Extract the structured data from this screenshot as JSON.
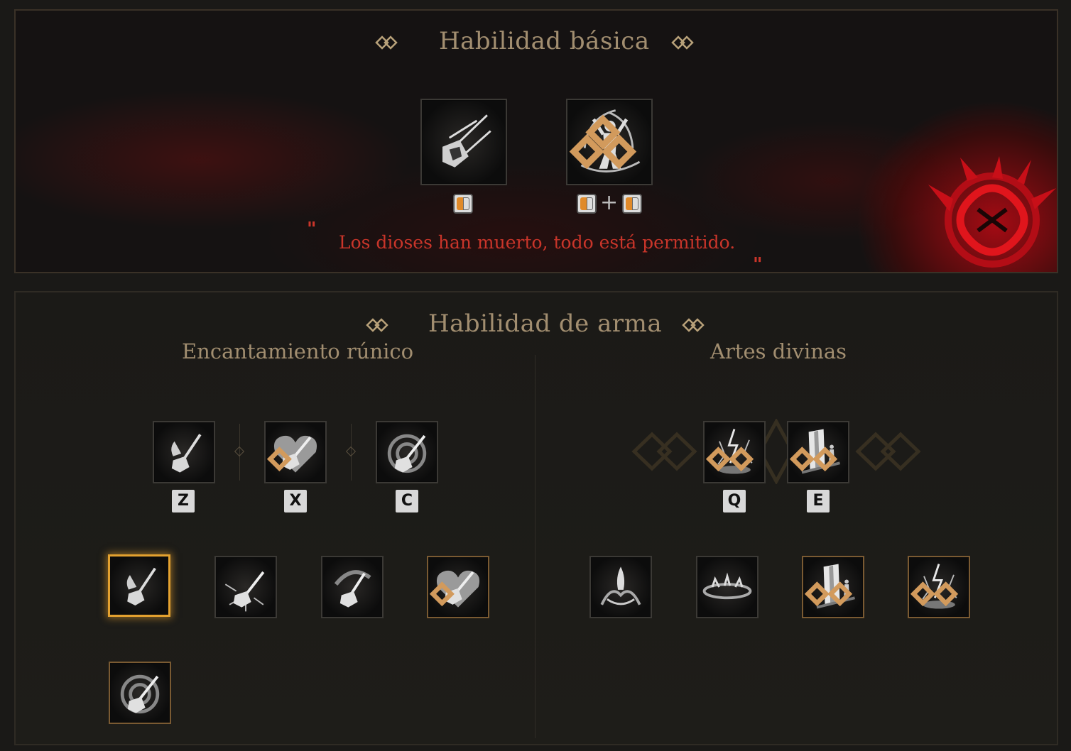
{
  "basic": {
    "title": "Habilidad básica",
    "skills": [
      {
        "icon": "hammer-dash-icon",
        "input": "left-click"
      },
      {
        "icon": "divine-figure-icon",
        "input": "left-click + left-click"
      }
    ],
    "quote": "Los dioses han muerto, todo está permitido.",
    "quote_open": "\"",
    "quote_close": "\""
  },
  "weapon": {
    "title": "Habilidad de arma",
    "left": {
      "title": "Encantamiento rúnico",
      "active_keys": [
        "Z",
        "X",
        "C"
      ]
    },
    "right": {
      "title": "Artes divinas",
      "active_keys": [
        "Q",
        "E"
      ]
    },
    "plus": "+"
  },
  "colors": {
    "accent_gold": "#e3a12f",
    "title_tan": "#a28e70",
    "quote_red": "#c9352a",
    "emblem_red": "#c80f18"
  }
}
